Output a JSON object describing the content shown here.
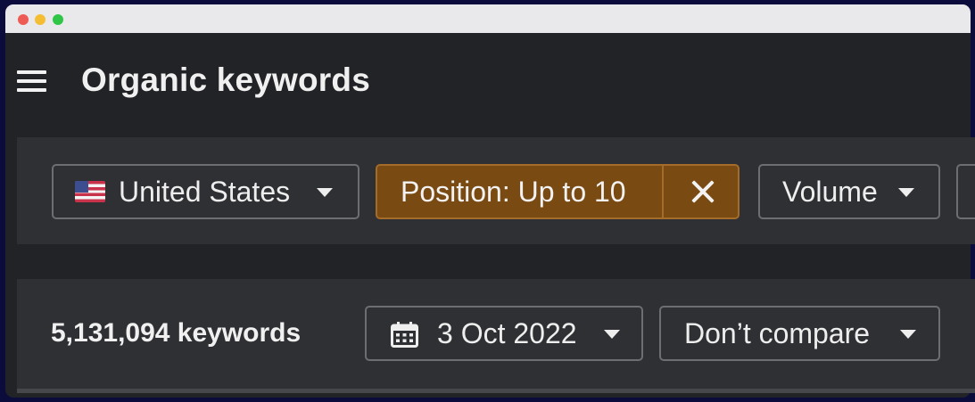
{
  "header": {
    "title": "Organic keywords"
  },
  "filters": {
    "country": {
      "label": "United States",
      "flag_icon": "us-flag-icon"
    },
    "position": {
      "label": "Position: Up to 10",
      "accent_color": "#7a4a13"
    },
    "volume": {
      "label": "Volume"
    }
  },
  "summary": {
    "keyword_count": "5,131,094 keywords",
    "date": {
      "label": "3 Oct 2022",
      "icon": "calendar-icon"
    },
    "compare": {
      "label": "Don’t compare"
    }
  }
}
